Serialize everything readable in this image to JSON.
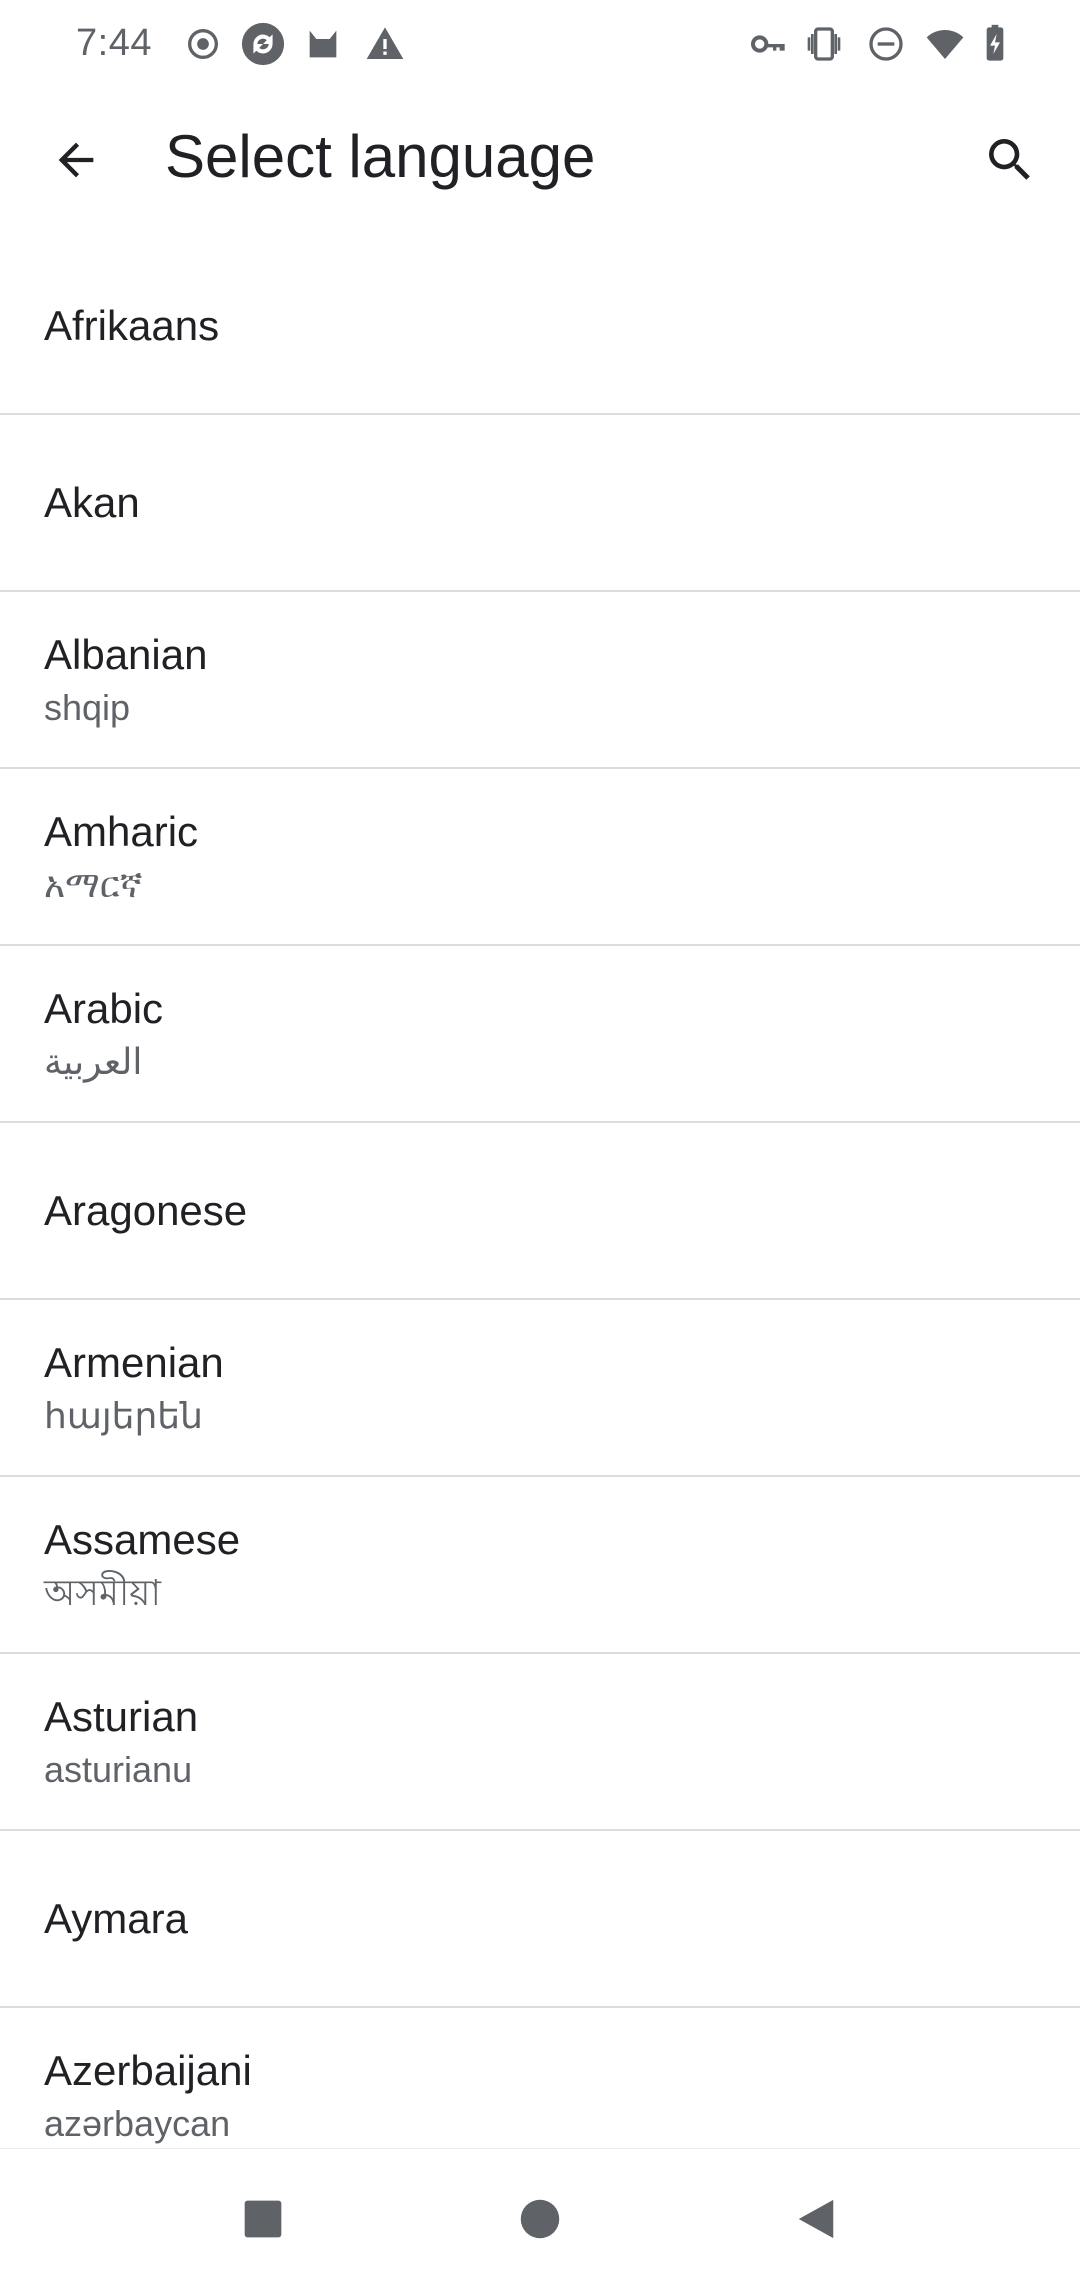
{
  "status_bar": {
    "time": "7:44",
    "left_icons": [
      "record-icon",
      "sync-icon",
      "cat-icon",
      "warning-icon"
    ],
    "right_icons": [
      "vpn-key-icon",
      "vibrate-icon",
      "do-not-disturb-icon",
      "wifi-icon",
      "battery-charging-icon"
    ]
  },
  "app_bar": {
    "title": "Select language",
    "back_icon": "arrow-back-icon",
    "search_icon": "search-icon"
  },
  "languages": [
    {
      "name": "Afrikaans",
      "native": ""
    },
    {
      "name": "Akan",
      "native": ""
    },
    {
      "name": "Albanian",
      "native": "shqip"
    },
    {
      "name": "Amharic",
      "native": "አማርኛ"
    },
    {
      "name": "Arabic",
      "native": "العربية"
    },
    {
      "name": "Aragonese",
      "native": ""
    },
    {
      "name": "Armenian",
      "native": "հայերեն"
    },
    {
      "name": "Assamese",
      "native": "অসমীয়া"
    },
    {
      "name": "Asturian",
      "native": "asturianu"
    },
    {
      "name": "Aymara",
      "native": ""
    },
    {
      "name": "Azerbaijani",
      "native": "azərbaycan"
    }
  ],
  "nav_bar": {
    "buttons": [
      "recents-square-icon",
      "home-circle-icon",
      "back-triangle-icon"
    ]
  },
  "colors": {
    "text_primary": "#202124",
    "text_secondary": "#5f6368",
    "divider": "#dadce0",
    "nav_icon": "#5f6368"
  }
}
